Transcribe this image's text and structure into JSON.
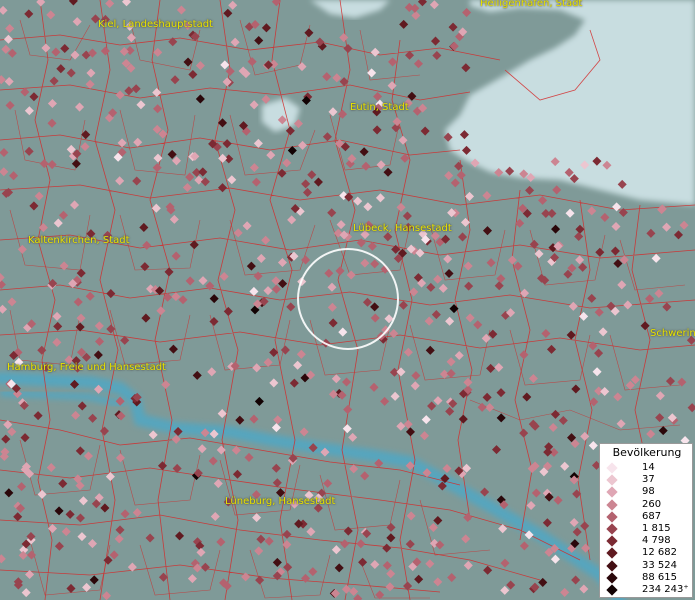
{
  "map": {
    "colors": {
      "land": "#7f9a98",
      "water": "#c8dde0",
      "river": "#4fa7c4",
      "borders": "#d42a2a",
      "label": "#e8e400",
      "highlight_ring": "#ffffff"
    },
    "cities": [
      {
        "name": "Kiel, Landeshauptstadt"
      },
      {
        "name": "Heiligenhafen, Stadt"
      },
      {
        "name": "Eutin, Stadt"
      },
      {
        "name": "Lübeck, Hansestadt"
      },
      {
        "name": "Kaltenkirchen, Stadt"
      },
      {
        "name": "Hamburg, Freie und Hansestadt"
      },
      {
        "name": "Schwerin"
      },
      {
        "name": "Lüneburg, Hansestadt"
      }
    ]
  },
  "legend": {
    "title": "Bevölkerung",
    "items": [
      {
        "label": "14",
        "color": "#f7e4ec"
      },
      {
        "label": "37",
        "color": "#ecc6d0"
      },
      {
        "label": "98",
        "color": "#dfa6b4"
      },
      {
        "label": "260",
        "color": "#cc8592"
      },
      {
        "label": "687",
        "color": "#b4626f"
      },
      {
        "label": "1 815",
        "color": "#98444f"
      },
      {
        "label": "4 798",
        "color": "#7c2a33"
      },
      {
        "label": "12 682",
        "color": "#601a20"
      },
      {
        "label": "33 524",
        "color": "#430f13"
      },
      {
        "label": "88 615",
        "color": "#2a070a"
      },
      {
        "label": "234 243⁺",
        "color": "#120203"
      }
    ]
  }
}
